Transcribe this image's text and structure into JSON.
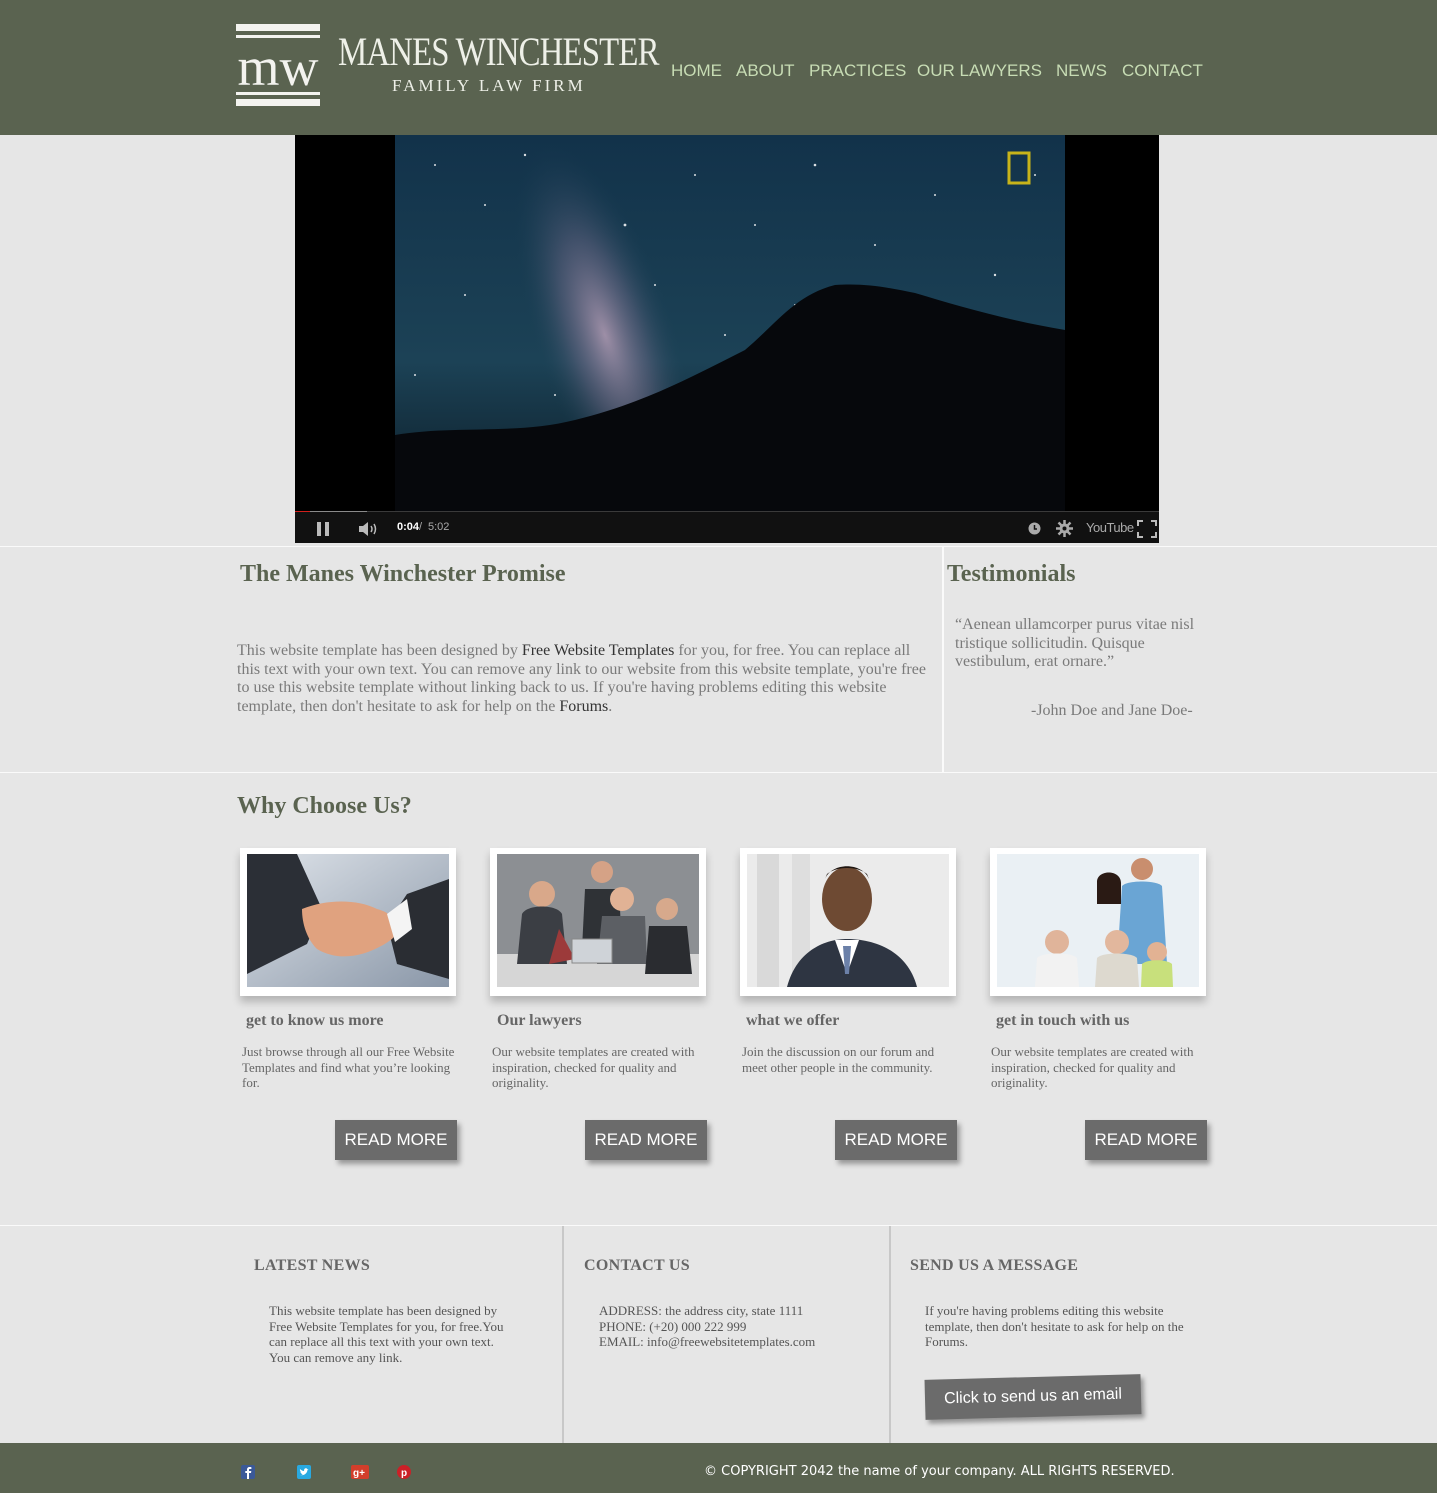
{
  "header": {
    "logo_monogram": "mw",
    "firm_name": "MANES WINCHESTER",
    "firm_subtitle": "FAMILY LAW FIRM",
    "nav": [
      "HOME",
      "ABOUT",
      "PRACTICES",
      "OUR LAWYERS",
      "NEWS",
      "CONTACT"
    ]
  },
  "video": {
    "current_time": "0:04",
    "separator": "/",
    "duration": "5:02",
    "progress_fraction": 0.013,
    "provider_label": "YouTube",
    "controls_icons": [
      "pause-icon",
      "volume-icon",
      "clock-icon",
      "gear-icon",
      "fullscreen-icon"
    ]
  },
  "promise": {
    "heading": "The Manes Winchester Promise",
    "body_1": "This website template has been designed by ",
    "link_1": "Free Website Templates",
    "body_2": " for you, for free. You can replace all this text with your own text. You can remove any link to our website from this website template, you're free to use this website template without linking back to us. If you're having problems editing this website template, then don't hesitate to ask for help on the ",
    "link_2": "Forums",
    "body_3": "."
  },
  "testimonials": {
    "heading": "Testimonials",
    "quote": "“Aenean ullamcorper purus vitae nisl tristique sollicitudin. Quisque vestibulum, erat ornare.”",
    "author": "-John Doe and Jane Doe-"
  },
  "why": {
    "heading": "Why Choose Us?",
    "cards": [
      {
        "title": "get to know us more",
        "text": "Just browse through all our Free Website Templates and find what you’re looking for.",
        "button": "READ MORE",
        "image": "handshake"
      },
      {
        "title": "Our lawyers",
        "text": "Our website templates are created with inspiration, checked for quality and originality.",
        "button": "READ MORE",
        "image": "business-meeting"
      },
      {
        "title": "what we offer",
        "text": "Join the discussion on our forum and meet other people in the community.",
        "button": "READ MORE",
        "image": "businessman-portrait"
      },
      {
        "title": "get in touch with us",
        "text": "Our website templates are created with inspiration, checked for quality and originality.",
        "button": "READ MORE",
        "image": "family"
      }
    ]
  },
  "footer": {
    "news_heading": "LATEST NEWS",
    "news_text": "This website template has been designed by Free Website Templates for you, for free.You can replace all this text with your own text. You can remove any link.",
    "contact_heading": "CONTACT US",
    "address": "ADDRESS: the address city, state 1111",
    "phone": "PHONE: (+20) 000 222 999",
    "email": "EMAIL: info@freewebsitetemplates.com",
    "message_heading": "SEND US A MESSAGE",
    "message_text": "If you're having problems editing this website template, then don't hesitate to ask for help on the Forums.",
    "email_button": "Click to send us an email"
  },
  "bottom": {
    "social": [
      "facebook-icon",
      "twitter-icon",
      "google-plus-icon",
      "pinterest-icon"
    ],
    "copyright": "© COPYRIGHT 2042 the name of your company. ALL RIGHTS RESERVED."
  },
  "colors": {
    "header_bg": "#5a6350",
    "nav_text": "#c7dcb4",
    "page_bg": "#e6e6e6",
    "heading_green": "#5a6350",
    "button_gray": "#6b6b6b"
  }
}
